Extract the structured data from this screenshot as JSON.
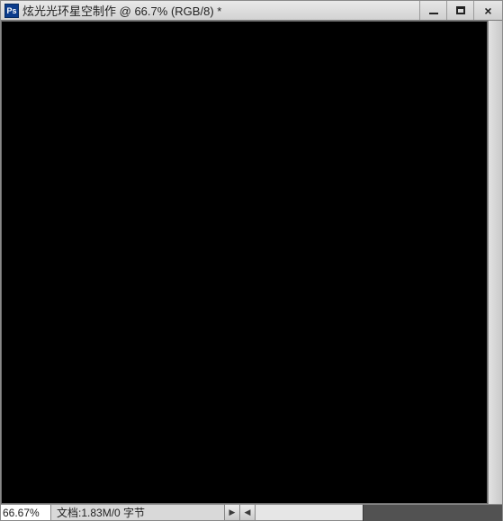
{
  "app": {
    "icon_label": "Ps"
  },
  "titlebar": {
    "document_name": "炫光光环星空制作",
    "zoom_label": "66.7%",
    "mode_label": "RGB/8",
    "modified_marker": "*"
  },
  "statusbar": {
    "zoom_value": "66.67%",
    "doc_label": "文档:",
    "doc_size": "1.83M/0 字节"
  },
  "colors": {
    "canvas_bg": "#000000",
    "chrome": "#d9d9d9"
  }
}
